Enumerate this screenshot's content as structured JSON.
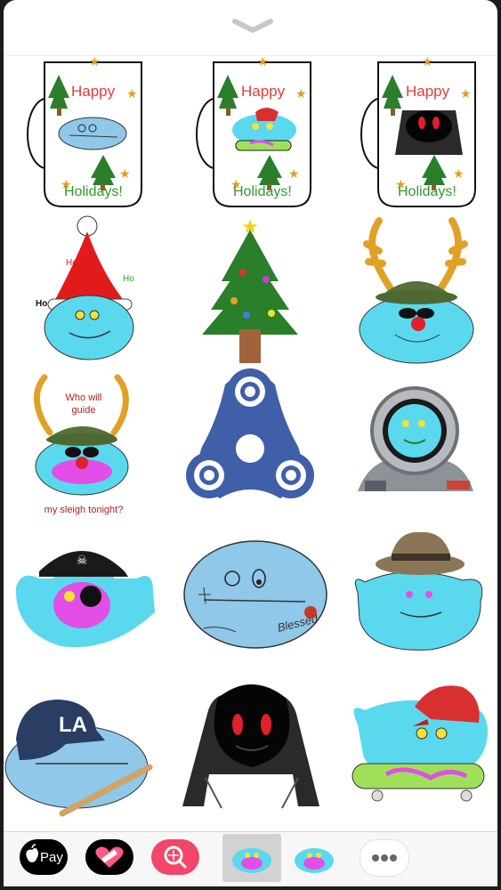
{
  "mugs": [
    {
      "top": "Happy",
      "bottom": "Holidays!"
    },
    {
      "top": "Happy",
      "bottom": "Holidays!"
    },
    {
      "top": "Happy",
      "bottom": "Holidays!"
    }
  ],
  "santa": {
    "ho1": "Ho",
    "ho2": "Ho",
    "ho3": "Ho"
  },
  "reindeer_caption": {
    "line1": "Who will",
    "line2": "guide",
    "line3": "my sleigh tonight?"
  },
  "blessed_text": "Blessed",
  "la_text": "LA",
  "dock": {
    "items": [
      "apple-pay",
      "heart-app",
      "image-search",
      "sticker-pack-selected",
      "sticker-pack",
      "more"
    ],
    "apple_pay_label": "Pay",
    "selected": "sticker-pack-selected"
  },
  "colors": {
    "blob": "#5ad8ee",
    "mug_text_red": "#e63b3b",
    "mug_text_green": "#2e9a2e",
    "tree_green": "#2a7f2a",
    "spinner_blue": "#3f5fa8",
    "mouth_pink": "#e24ee6",
    "sheet_bg": "#ffffff",
    "dock_bg": "#f7f7f7"
  }
}
